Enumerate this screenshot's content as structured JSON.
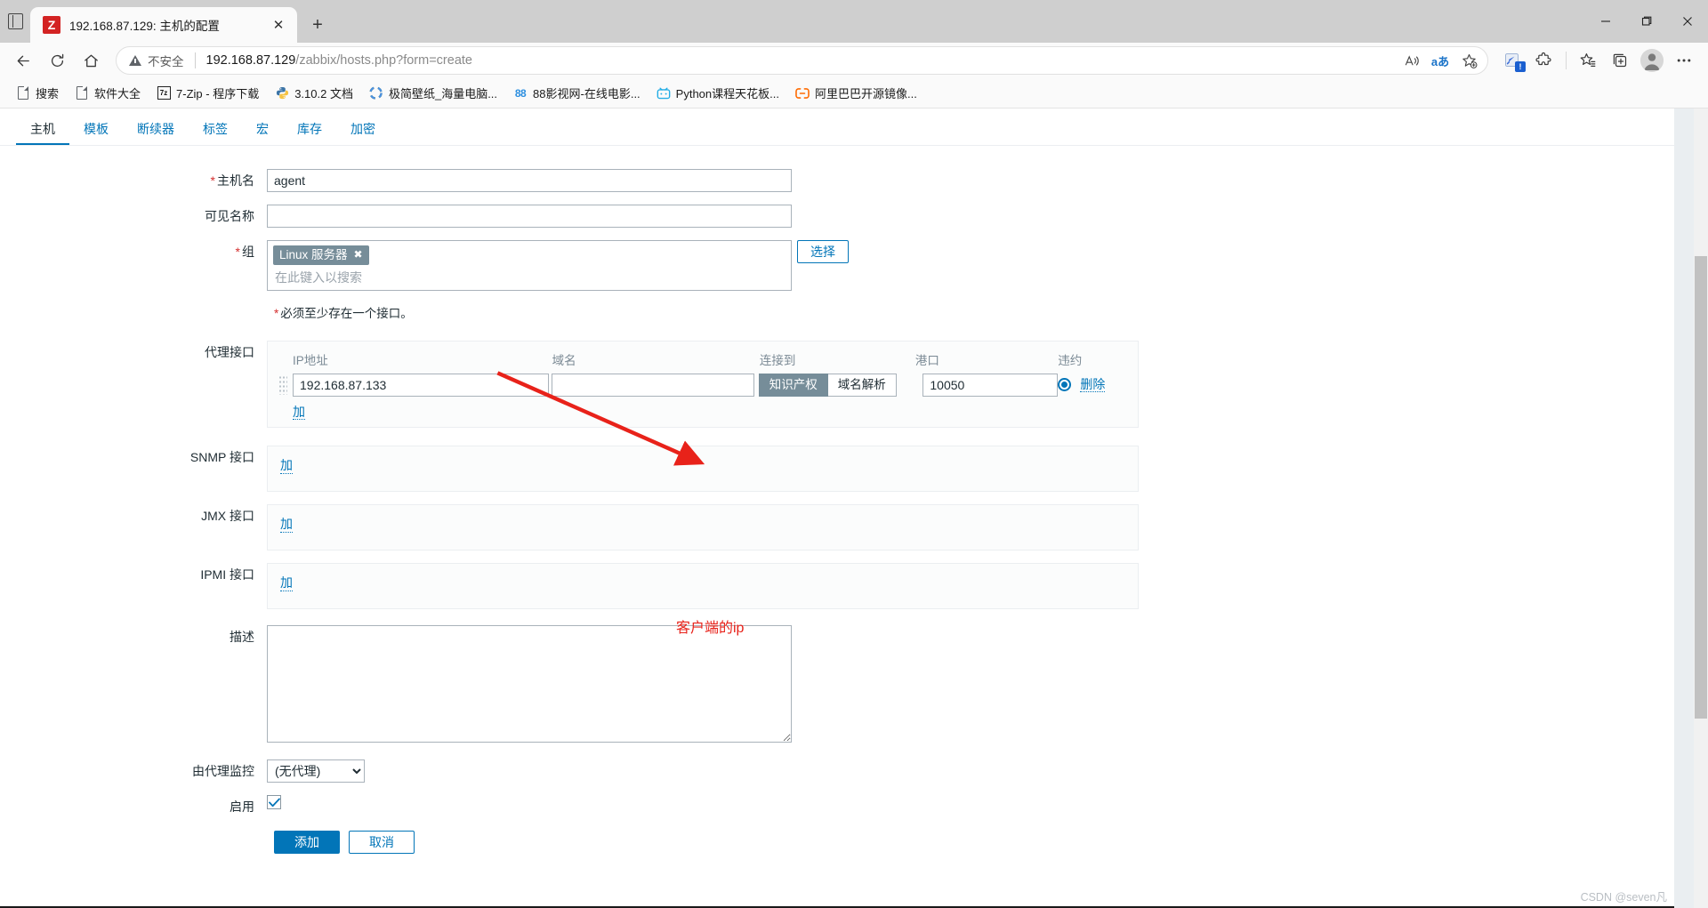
{
  "browser": {
    "tab": {
      "title": "192.168.87.129: 主机的配置",
      "favicon_letter": "Z",
      "close_label": "✕"
    },
    "new_tab_label": "+",
    "tablist_icon": "tab-list-icon",
    "nav": {
      "back": "←",
      "reload": "↻",
      "home": "⌂"
    },
    "omnibox": {
      "security_label": "不安全",
      "url_host": "192.168.87.129",
      "url_path": "/zabbix/hosts.php?form=create",
      "read_aloud": "A",
      "translate": "aあ",
      "favorite": "☆"
    },
    "window": {
      "minimize": "—",
      "maximize": "❐",
      "close": "✕"
    },
    "bookmarks": [
      {
        "label": "搜索",
        "icon": "document-icon"
      },
      {
        "label": "软件大全",
        "icon": "document-icon"
      },
      {
        "label": "7-Zip - 程序下载",
        "icon": "sevenzip-icon"
      },
      {
        "label": "3.10.2 文档",
        "icon": "python-icon"
      },
      {
        "label": "极简壁纸_海量电脑...",
        "icon": "wallpaper-icon"
      },
      {
        "label": "88影视网-在线电影...",
        "icon": "88-icon"
      },
      {
        "label": "Python课程天花板...",
        "icon": "bilibili-icon"
      },
      {
        "label": "阿里巴巴开源镜像...",
        "icon": "aliyun-icon"
      }
    ]
  },
  "zabbix": {
    "tabs": [
      {
        "label": "主机",
        "active": true
      },
      {
        "label": "模板",
        "active": false
      },
      {
        "label": "断续器",
        "active": false
      },
      {
        "label": "标签",
        "active": false
      },
      {
        "label": "宏",
        "active": false
      },
      {
        "label": "库存",
        "active": false
      },
      {
        "label": "加密",
        "active": false
      }
    ],
    "form": {
      "hostname": {
        "label": "主机名",
        "required": true,
        "value": "agent"
      },
      "visible_name": {
        "label": "可见名称",
        "required": false,
        "value": ""
      },
      "groups": {
        "label": "组",
        "required": true,
        "chips": [
          "Linux 服务器"
        ],
        "chip_remove": "✖",
        "placeholder": "在此键入以搜索",
        "select_button": "选择"
      },
      "interface_hint": "必须至少存在一个接口。",
      "agent_interface": {
        "label": "代理接口",
        "headers": [
          "IP地址",
          "域名",
          "连接到",
          "港口",
          "违约"
        ],
        "rows": [
          {
            "ip": "192.168.87.133",
            "dns": "",
            "connect_to": {
              "options": [
                "知识产权",
                "域名解析"
              ],
              "selected": "知识产权"
            },
            "port": "10050",
            "default_selected": true,
            "remove_label": "删除"
          }
        ],
        "add_label": "加"
      },
      "snmp_interface": {
        "label": "SNMP 接口",
        "add_label": "加"
      },
      "jmx_interface": {
        "label": "JMX 接口",
        "add_label": "加"
      },
      "ipmi_interface": {
        "label": "IPMI 接口",
        "add_label": "加"
      },
      "description": {
        "label": "描述",
        "value": ""
      },
      "monitored_by_proxy": {
        "label": "由代理监控",
        "selected": "(无代理)",
        "options": [
          "(无代理)"
        ]
      },
      "enabled": {
        "label": "启用",
        "checked": true
      },
      "buttons": {
        "submit": "添加",
        "cancel": "取消"
      }
    }
  },
  "annotation": {
    "text": "客户端的ip",
    "color": "#e8221a"
  },
  "watermark": "CSDN @seven凡"
}
